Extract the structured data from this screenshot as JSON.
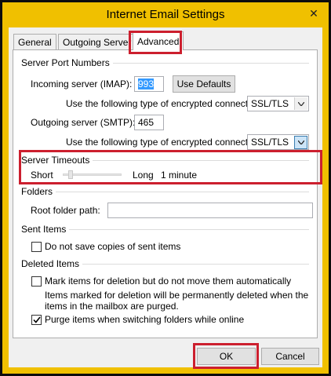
{
  "window": {
    "title": "Internet Email Settings",
    "close_glyph": "✕"
  },
  "tabs": [
    {
      "label": "General",
      "active": false
    },
    {
      "label": "Outgoing Server",
      "active": false
    },
    {
      "label": "Advanced",
      "active": true
    }
  ],
  "server_ports": {
    "group_label": "Server Port Numbers",
    "incoming_label": "Incoming server (IMAP):",
    "incoming_value": "993",
    "use_defaults_label": "Use Defaults",
    "incoming_encryption_label": "Use the following type of encrypted connection:",
    "incoming_encryption_value": "SSL/TLS",
    "outgoing_label": "Outgoing server (SMTP):",
    "outgoing_value": "465",
    "outgoing_encryption_label": "Use the following type of encrypted connection:",
    "outgoing_encryption_value": "SSL/TLS"
  },
  "server_timeouts": {
    "group_label": "Server Timeouts",
    "short_label": "Short",
    "long_label": "Long",
    "value_text": "1 minute",
    "slider_position": 0.1
  },
  "folders": {
    "group_label": "Folders",
    "root_folder_label": "Root folder path:",
    "root_folder_value": ""
  },
  "sent_items": {
    "group_label": "Sent Items",
    "no_copies_label": "Do not save copies of sent items",
    "no_copies_checked": false
  },
  "deleted_items": {
    "group_label": "Deleted Items",
    "mark_label": "Mark items for deletion but do not move them automatically",
    "mark_checked": false,
    "note_line1": "Items marked for deletion will be permanently deleted when the",
    "note_line2": "items in the mailbox are purged.",
    "purge_label": "Purge items when switching folders while online",
    "purge_checked": true
  },
  "footer": {
    "ok_label": "OK",
    "cancel_label": "Cancel"
  },
  "colors": {
    "title_bar": "#f0c000",
    "highlight_box": "#cc1f2e",
    "selection": "#3399ff"
  }
}
